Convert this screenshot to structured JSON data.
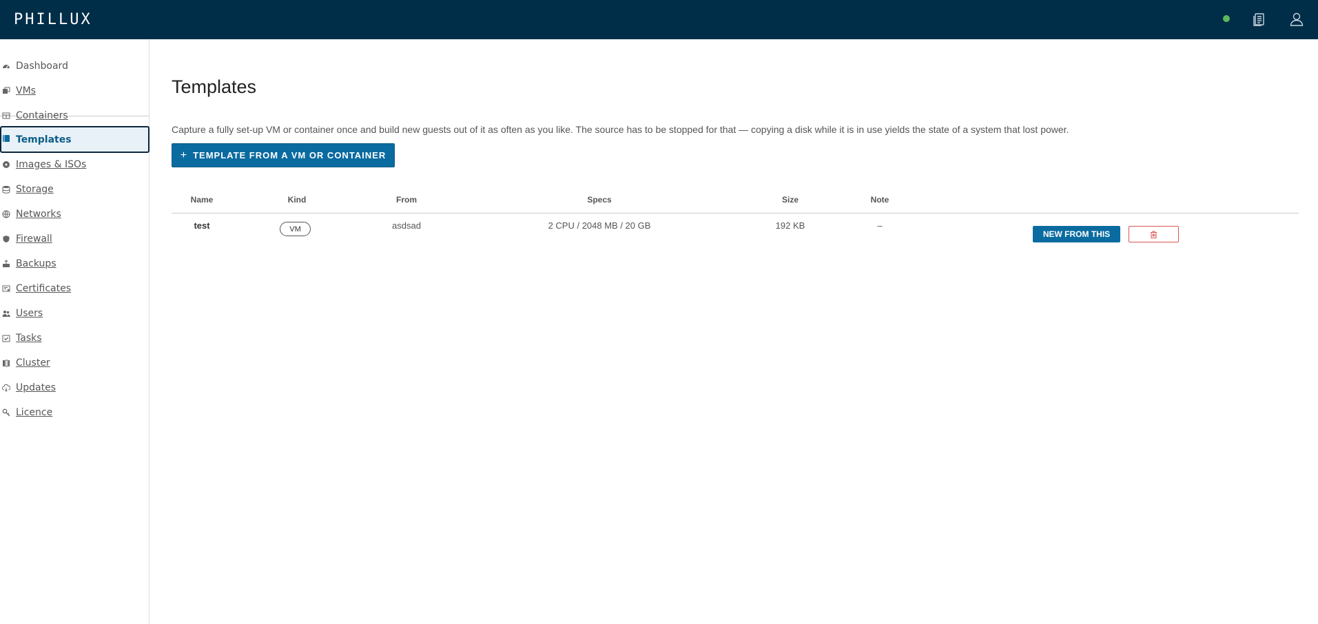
{
  "app": {
    "logo": "PHILLUX"
  },
  "header": {
    "status_color": "#5cb85c",
    "docs_icon": "docs-icon",
    "user_icon": "user-icon"
  },
  "sidebar": {
    "items": [
      {
        "label": "Dashboard",
        "icon": "dashboard-icon"
      },
      {
        "label": "VMs",
        "icon": "vms-icon"
      },
      {
        "label": "Containers",
        "icon": "containers-icon"
      },
      {
        "label": "Templates",
        "icon": "templates-icon",
        "active": true
      },
      {
        "label": "Images & ISOs",
        "icon": "images-icon"
      },
      {
        "label": "Storage",
        "icon": "storage-icon"
      },
      {
        "label": "Networks",
        "icon": "networks-icon"
      },
      {
        "label": "Firewall",
        "icon": "firewall-icon"
      },
      {
        "label": "Backups",
        "icon": "backups-icon"
      },
      {
        "label": "Certificates",
        "icon": "certificates-icon"
      },
      {
        "label": "Users",
        "icon": "users-icon"
      },
      {
        "label": "Tasks",
        "icon": "tasks-icon"
      },
      {
        "label": "Cluster",
        "icon": "cluster-icon"
      },
      {
        "label": "Updates",
        "icon": "updates-icon"
      },
      {
        "label": "Licence",
        "icon": "licence-icon"
      }
    ]
  },
  "main": {
    "title": "Templates",
    "intro": "Capture a fully set-up VM or container once and build new guests out of it as often as you like. The source has to be stopped for that — copying a disk while it is in use yields the state of a system that lost power.",
    "create_button": {
      "plus": "+",
      "label": "TEMPLATE FROM A VM OR CONTAINER"
    },
    "table": {
      "columns": [
        "Name",
        "Kind",
        "From",
        "Specs",
        "Size",
        "Note"
      ],
      "rows": [
        {
          "name": "test",
          "kind": "VM",
          "from": "asdsad",
          "specs": "2 CPU / 2048 MB / 20 GB",
          "size": "192 KB",
          "note": "–",
          "new_label": "NEW FROM THIS",
          "delete_icon": "trash-icon"
        }
      ]
    }
  },
  "colors": {
    "header_bg": "#002d48",
    "accent": "#0a6ba0",
    "danger": "#d9534f",
    "active_nav_bg": "#e8f1f8"
  }
}
